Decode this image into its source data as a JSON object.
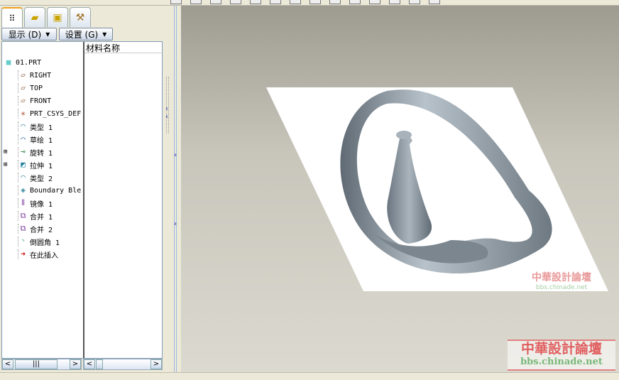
{
  "panel": {
    "display_button": "显示 (D)",
    "settings_button": "设置 (G)",
    "column_header": "材料名称",
    "tabs": [
      "model-tree",
      "layers",
      "favorites",
      "tools"
    ]
  },
  "tree": [
    {
      "label": "01.PRT",
      "icon": "part-icon"
    },
    {
      "label": "RIGHT",
      "icon": "datum-plane-icon"
    },
    {
      "label": "TOP",
      "icon": "datum-plane-icon"
    },
    {
      "label": "FRONT",
      "icon": "datum-plane-icon"
    },
    {
      "label": "PRT_CSYS_DEF",
      "icon": "csys-icon"
    },
    {
      "label": "类型 1",
      "icon": "surface-icon"
    },
    {
      "label": "草绘 1",
      "icon": "sketch-icon"
    },
    {
      "label": "旋转 1",
      "icon": "revolve-icon",
      "expandable": true
    },
    {
      "label": "拉伸 1",
      "icon": "extrude-icon",
      "expandable": true
    },
    {
      "label": "类型 2",
      "icon": "surface-icon"
    },
    {
      "label": "Boundary Ble",
      "icon": "boundary-blend-icon"
    },
    {
      "label": "镜像 1",
      "icon": "mirror-icon"
    },
    {
      "label": "合并 1",
      "icon": "merge-icon"
    },
    {
      "label": "合并 2",
      "icon": "merge-icon"
    },
    {
      "label": "倒圆角 1",
      "icon": "round-icon"
    },
    {
      "label": "在此插入",
      "icon": "insert-here-icon"
    }
  ],
  "watermark": {
    "cn": "中華設計論壇",
    "en": "bbs.chinade.net"
  },
  "colors": {
    "viewport_top": "#9e9b91",
    "viewport_bottom": "#dcdad0",
    "model": "#8e99a2",
    "insert_arrow": "#cc0000"
  }
}
